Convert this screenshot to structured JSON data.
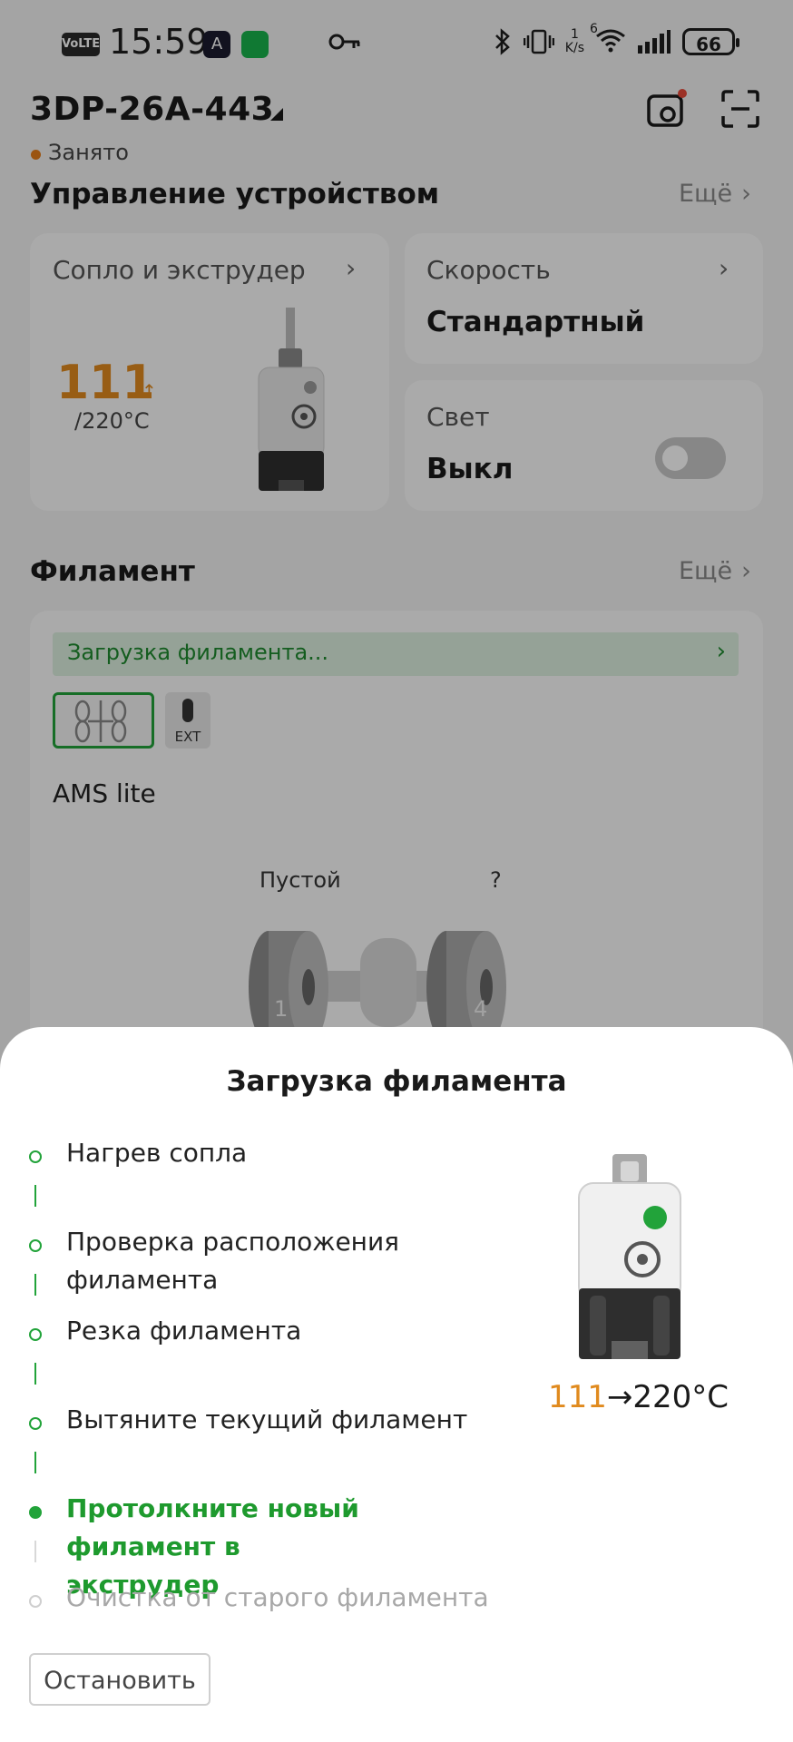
{
  "status_bar": {
    "volte": "VoLTE",
    "time": "15:59",
    "app1_glyph": "A",
    "net_speed_value": "1",
    "net_speed_unit": "K/s",
    "wifi_badge": "6",
    "battery": "66"
  },
  "header": {
    "device_name": "3DP-26A-443",
    "status": "Занято",
    "status_color": "#e57c1a"
  },
  "device_control": {
    "title": "Управление устройством",
    "more": "Ещё",
    "nozzle": {
      "label": "Сопло и экструдер",
      "current_temp": "111",
      "target_temp": "/220°C"
    },
    "speed": {
      "label": "Скорость",
      "value": "Стандартный"
    },
    "light": {
      "label": "Свет",
      "value": "Выкл"
    }
  },
  "filament": {
    "title": "Филамент",
    "more": "Ещё",
    "loading_banner": "Загрузка филамента...",
    "ext_label": "EXT",
    "ams_name": "AMS lite",
    "slots": [
      {
        "label": "Пустой",
        "number": "1"
      },
      {
        "label": "?",
        "number": "4"
      }
    ]
  },
  "sheet": {
    "title": "Загрузка филамента",
    "steps": [
      {
        "line1": "Нагрев сопла",
        "line2": "",
        "state": "done"
      },
      {
        "line1": "Проверка расположения",
        "line2": "филамента",
        "state": "done"
      },
      {
        "line1": "Резка филамента",
        "line2": "",
        "state": "done"
      },
      {
        "line1": "Вытяните текущий филамент",
        "line2": "",
        "state": "done"
      },
      {
        "line1": "Протолкните новый филамент в",
        "line2": "экструдер",
        "state": "active"
      },
      {
        "line1": "Очистка от старого филамента",
        "line2": "",
        "state": "pending"
      }
    ],
    "temp_current": "111",
    "temp_arrow": "→",
    "temp_target": "220°C",
    "stop_button": "Остановить",
    "accent_color": "#22a33a"
  }
}
